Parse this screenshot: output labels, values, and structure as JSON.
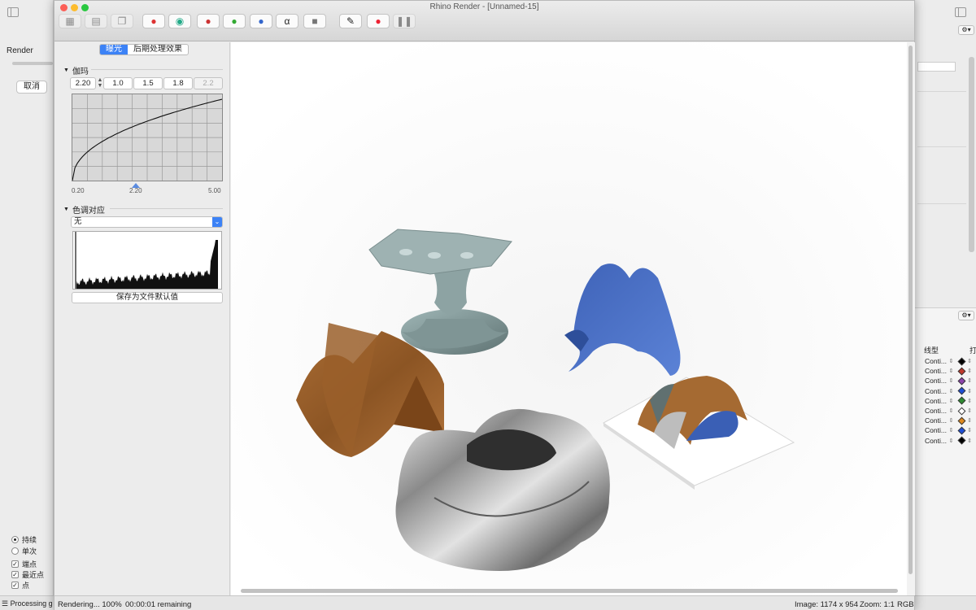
{
  "window": {
    "title": "Rhino Render - [Unnamed-15]"
  },
  "background_app": {
    "render_label": "Render",
    "cancel_label": "取消",
    "osnap_options": [
      {
        "label": "持续",
        "kind": "radio",
        "checked": true
      },
      {
        "label": "单次",
        "kind": "radio",
        "checked": false
      },
      {
        "label": "端点",
        "kind": "check",
        "checked": true
      },
      {
        "label": "最近点",
        "kind": "check",
        "checked": true
      },
      {
        "label": "点",
        "kind": "check",
        "checked": true
      }
    ],
    "status_text": "Processing g"
  },
  "layers_panel": {
    "linetype_header": "线型",
    "extra_header": "打",
    "rows": [
      {
        "linetype": "Conti...",
        "color": "#000000"
      },
      {
        "linetype": "Conti...",
        "color": "#c0392b"
      },
      {
        "linetype": "Conti...",
        "color": "#8e44ad"
      },
      {
        "linetype": "Conti...",
        "color": "#1f4fd6"
      },
      {
        "linetype": "Conti...",
        "color": "#2e8b32"
      },
      {
        "linetype": "Conti...",
        "color": "#ffffff"
      },
      {
        "linetype": "Conti...",
        "color": "#e08a1e"
      },
      {
        "linetype": "Conti...",
        "color": "#1f4fd6"
      },
      {
        "linetype": "Conti...",
        "color": "#000000"
      }
    ]
  },
  "toolbar": {
    "buttons": [
      {
        "name": "save-icon",
        "glyph": "▦",
        "enabled": false
      },
      {
        "name": "save-as-icon",
        "glyph": "▤",
        "enabled": false
      },
      {
        "name": "copy-icon",
        "glyph": "❐",
        "enabled": false
      },
      {
        "name": "rgb-channels-icon",
        "glyph": "●",
        "enabled": true
      },
      {
        "name": "rgb-active-icon",
        "glyph": "◉",
        "enabled": true
      },
      {
        "name": "red-channel-icon",
        "glyph": "●",
        "enabled": true
      },
      {
        "name": "green-channel-icon",
        "glyph": "●",
        "enabled": true
      },
      {
        "name": "blue-channel-icon",
        "glyph": "●",
        "enabled": true
      },
      {
        "name": "alpha-channel-icon",
        "glyph": "α",
        "enabled": true
      },
      {
        "name": "cube-icon",
        "glyph": "■",
        "enabled": true
      },
      {
        "name": "wand-icon",
        "glyph": "✎",
        "enabled": true
      },
      {
        "name": "stop-render-icon",
        "glyph": "●",
        "enabled": true
      },
      {
        "name": "pause-icon",
        "glyph": "❚❚",
        "enabled": false
      }
    ]
  },
  "tabs": [
    {
      "label": "曝光",
      "active": true
    },
    {
      "label": "后期处理效果",
      "active": false
    }
  ],
  "gamma": {
    "section_title": "伽玛",
    "value": "2.20",
    "presets": [
      "1.0",
      "1.5",
      "1.8",
      "2.2"
    ],
    "axis_min_label": "0.20",
    "axis_mid_label": "2.20",
    "axis_max_label": "5.00",
    "axis_min": 0.2,
    "axis_max": 5.0,
    "gamma_value": 2.2
  },
  "tone_mapping": {
    "section_title": "色调对应",
    "selected": "无",
    "save_default_label": "保存为文件默认值"
  },
  "status": {
    "rendering": "Rendering... 100%",
    "remaining": "00:00:01 remaining",
    "image_size": "Image: 1174 x 954",
    "zoom": "Zoom: 1:1",
    "mode": "RGB"
  }
}
